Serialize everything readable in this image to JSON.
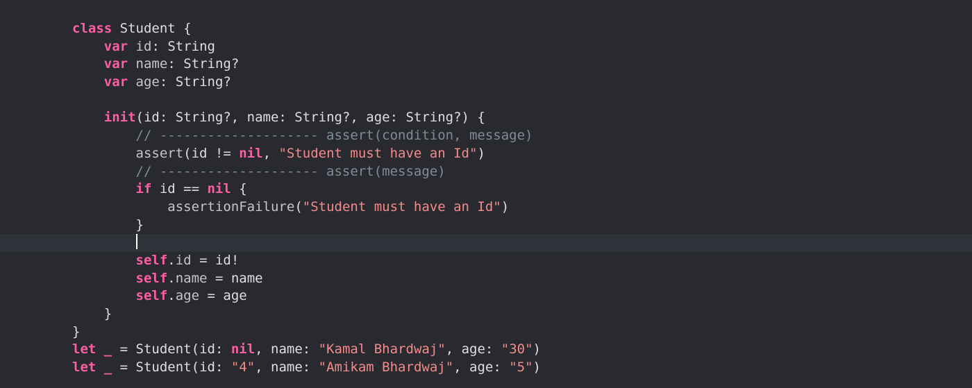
{
  "editor": {
    "language": "swift",
    "theme": {
      "background": "#292a30",
      "keyword": "#fc5fa3",
      "string": "#f28b8b",
      "comment": "#7f8c98",
      "text": "#dfdfe0"
    },
    "lines": [
      [
        {
          "t": "kw",
          "v": "class"
        },
        {
          "t": "plain",
          "v": " Student {"
        }
      ],
      [
        {
          "t": "plain",
          "v": "    "
        },
        {
          "t": "kw",
          "v": "var"
        },
        {
          "t": "plain",
          "v": " "
        },
        {
          "t": "prop",
          "v": "id"
        },
        {
          "t": "plain",
          "v": ": String"
        }
      ],
      [
        {
          "t": "plain",
          "v": "    "
        },
        {
          "t": "kw",
          "v": "var"
        },
        {
          "t": "plain",
          "v": " "
        },
        {
          "t": "prop",
          "v": "name"
        },
        {
          "t": "plain",
          "v": ": String?"
        }
      ],
      [
        {
          "t": "plain",
          "v": "    "
        },
        {
          "t": "kw",
          "v": "var"
        },
        {
          "t": "plain",
          "v": " "
        },
        {
          "t": "prop",
          "v": "age"
        },
        {
          "t": "plain",
          "v": ": String?"
        }
      ],
      [],
      [
        {
          "t": "plain",
          "v": "    "
        },
        {
          "t": "kw",
          "v": "init"
        },
        {
          "t": "plain",
          "v": "(id: String?, name: String?, age: String?) {"
        }
      ],
      [
        {
          "t": "plain",
          "v": "        "
        },
        {
          "t": "cm",
          "v": "// -------------------- assert(condition, message)"
        }
      ],
      [
        {
          "t": "plain",
          "v": "        "
        },
        {
          "t": "fn",
          "v": "assert"
        },
        {
          "t": "plain",
          "v": "(id != "
        },
        {
          "t": "kw",
          "v": "nil"
        },
        {
          "t": "plain",
          "v": ", "
        },
        {
          "t": "str",
          "v": "\"Student must have an Id\""
        },
        {
          "t": "plain",
          "v": ")"
        }
      ],
      [
        {
          "t": "plain",
          "v": "        "
        },
        {
          "t": "cm",
          "v": "// -------------------- assert(message)"
        }
      ],
      [
        {
          "t": "plain",
          "v": "        "
        },
        {
          "t": "kw",
          "v": "if"
        },
        {
          "t": "plain",
          "v": " id == "
        },
        {
          "t": "kw",
          "v": "nil"
        },
        {
          "t": "plain",
          "v": " {"
        }
      ],
      [
        {
          "t": "plain",
          "v": "            "
        },
        {
          "t": "fn",
          "v": "assertionFailure"
        },
        {
          "t": "plain",
          "v": "("
        },
        {
          "t": "str",
          "v": "\"Student must have an Id\""
        },
        {
          "t": "plain",
          "v": ")"
        }
      ],
      [
        {
          "t": "plain",
          "v": "        }"
        }
      ],
      [
        {
          "t": "plain",
          "v": "        "
        },
        {
          "t": "cursor",
          "v": ""
        }
      ],
      [
        {
          "t": "plain",
          "v": "        "
        },
        {
          "t": "kw",
          "v": "self"
        },
        {
          "t": "plain",
          "v": "."
        },
        {
          "t": "prop",
          "v": "id"
        },
        {
          "t": "plain",
          "v": " = id!"
        }
      ],
      [
        {
          "t": "plain",
          "v": "        "
        },
        {
          "t": "kw",
          "v": "self"
        },
        {
          "t": "plain",
          "v": "."
        },
        {
          "t": "prop",
          "v": "name"
        },
        {
          "t": "plain",
          "v": " = name"
        }
      ],
      [
        {
          "t": "plain",
          "v": "        "
        },
        {
          "t": "kw",
          "v": "self"
        },
        {
          "t": "plain",
          "v": "."
        },
        {
          "t": "prop",
          "v": "age"
        },
        {
          "t": "plain",
          "v": " = age"
        }
      ],
      [
        {
          "t": "plain",
          "v": "    }"
        }
      ],
      [
        {
          "t": "plain",
          "v": "}"
        }
      ],
      [
        {
          "t": "kw",
          "v": "let"
        },
        {
          "t": "plain",
          "v": " "
        },
        {
          "t": "kw",
          "v": "_"
        },
        {
          "t": "plain",
          "v": " = Student(id: "
        },
        {
          "t": "kw",
          "v": "nil"
        },
        {
          "t": "plain",
          "v": ", name: "
        },
        {
          "t": "str",
          "v": "\"Kamal Bhardwaj\""
        },
        {
          "t": "plain",
          "v": ", age: "
        },
        {
          "t": "str",
          "v": "\"30\""
        },
        {
          "t": "plain",
          "v": ")"
        }
      ],
      [
        {
          "t": "kw",
          "v": "let"
        },
        {
          "t": "plain",
          "v": " "
        },
        {
          "t": "kw",
          "v": "_"
        },
        {
          "t": "plain",
          "v": " = Student(id: "
        },
        {
          "t": "str",
          "v": "\"4\""
        },
        {
          "t": "plain",
          "v": ", name: "
        },
        {
          "t": "str",
          "v": "\"Amikam Bhardwaj\""
        },
        {
          "t": "plain",
          "v": ", age: "
        },
        {
          "t": "str",
          "v": "\"5\""
        },
        {
          "t": "plain",
          "v": ")"
        }
      ]
    ]
  }
}
